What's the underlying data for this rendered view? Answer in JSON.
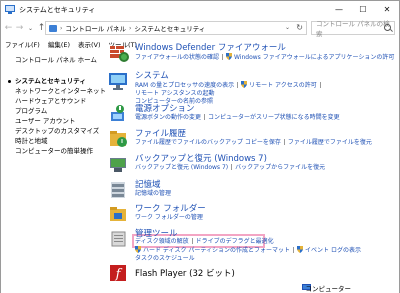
{
  "window": {
    "title": "システムとセキュリティ",
    "minimize": "—",
    "maximize": "☐",
    "close": "✕"
  },
  "address": {
    "back": "←",
    "forward": "→",
    "recent": "⌄",
    "up": "↑",
    "breadcrumbs": [
      "コントロール パネル",
      "システムとセキュリティ"
    ],
    "separator": "›",
    "dropdown": "⌄",
    "refresh": "↻",
    "search_placeholder": "コントロール パネルの検索"
  },
  "menu": [
    "ファイル(F)",
    "編集(E)",
    "表示(V)",
    "ツール(T)"
  ],
  "sidebar": {
    "home": "コントロール パネル ホーム",
    "items": [
      {
        "label": "システムとセキュリティ",
        "active": true
      },
      {
        "label": "ネットワークとインターネット",
        "active": false
      },
      {
        "label": "ハードウェアとサウンド",
        "active": false
      },
      {
        "label": "プログラム",
        "active": false
      },
      {
        "label": "ユーザー アカウント",
        "active": false
      },
      {
        "label": "デスクトップのカスタマイズ",
        "active": false
      },
      {
        "label": "時計と地域",
        "active": false
      },
      {
        "label": "コンピューターの簡単操作",
        "active": false
      }
    ]
  },
  "categories": [
    {
      "title": "Windows Defender ファイアウォール",
      "lines": [
        [
          "ファイアウォールの状態の確認",
          "#Windows ファイアウォールによるアプリケーションの許可"
        ]
      ]
    },
    {
      "title": "システム",
      "lines": [
        [
          "RAM の量とプロセッサの速度の表示",
          "#リモート アクセスの許可",
          "リモート アシスタンスの起動"
        ],
        [
          "コンピューターの名前の参照"
        ]
      ]
    },
    {
      "title": "電源オプション",
      "lines": [
        [
          "電源ボタンの動作の変更",
          "コンピューターがスリープ状態になる時間を変更"
        ]
      ]
    },
    {
      "title": "ファイル履歴",
      "lines": [
        [
          "ファイル履歴でファイルのバックアップ コピーを保存",
          "ファイル履歴でファイルを復元"
        ]
      ]
    },
    {
      "title": "バックアップと復元 (Windows 7)",
      "lines": [
        [
          "バックアップと復元 (Windows 7)",
          "バックアップからファイルを復元"
        ]
      ]
    },
    {
      "title": "記憶域",
      "lines": [
        [
          "記憶域の管理"
        ]
      ]
    },
    {
      "title": "ワーク フォルダー",
      "lines": [
        [
          "ワーク フォルダーの管理"
        ]
      ]
    },
    {
      "title": "管理ツール",
      "lines": [
        [
          "ディスク領域の解放",
          "ドライブのデフラグと最適化"
        ],
        [
          "#ハード ディスク パーティションの作成とフォーマット",
          "#イベント ログの表示"
        ],
        [
          "タスクのスケジュール"
        ]
      ]
    },
    {
      "title": "Flash Player (32 ビット)",
      "lines": []
    }
  ],
  "status": {
    "text": "コンピューター"
  },
  "colors": {
    "link": "#1f51b5",
    "highlight": "#f3a5c4"
  }
}
